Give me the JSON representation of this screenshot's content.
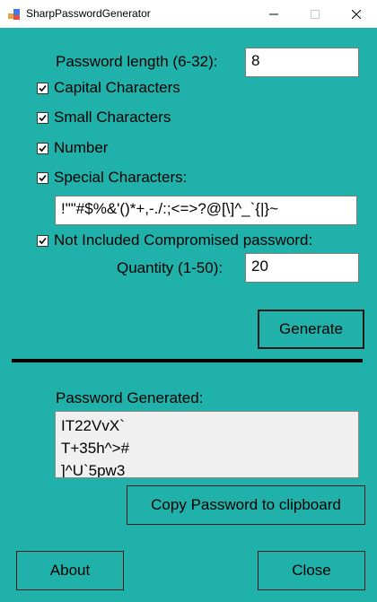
{
  "window": {
    "title": "SharpPasswordGenerator"
  },
  "length": {
    "label": "Password length (6-32):",
    "value": "8"
  },
  "options": {
    "capital": {
      "label": "Capital Characters",
      "checked": true
    },
    "small": {
      "label": "Small Characters",
      "checked": true
    },
    "number": {
      "label": "Number",
      "checked": true
    },
    "special": {
      "label": "Special Characters:",
      "checked": true
    },
    "special_chars": "!\"\"#$%&'()*+,-./:;<=>?@[\\]^_`{|}~",
    "compromised": {
      "label": "Not Included Compromised password:",
      "checked": true
    }
  },
  "quantity": {
    "label": "Quantity (1-50):",
    "value": "20"
  },
  "buttons": {
    "generate": "Generate",
    "copy": "Copy Password to clipboard",
    "about": "About",
    "close": "Close"
  },
  "output": {
    "label": "Password Generated:",
    "passwords": [
      "IT22VvX`",
      "T+35h^>#",
      "]^U`5pw3"
    ]
  },
  "colors": {
    "background": "#20b2aa",
    "divider": "#000000"
  },
  "icons": {
    "app": "app-icon",
    "minimize": "minimize-icon",
    "maximize": "maximize-icon",
    "close": "close-icon",
    "check": "checkmark-icon"
  }
}
